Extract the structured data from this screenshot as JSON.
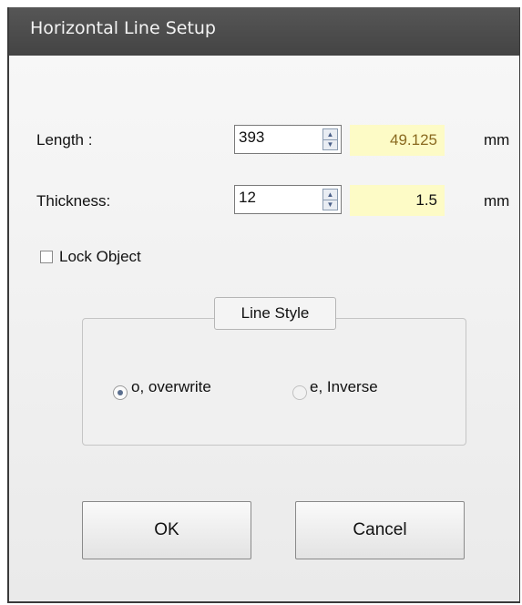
{
  "window": {
    "title": "Horizontal Line Setup"
  },
  "length": {
    "label": "Length :",
    "value": "393",
    "mm_value": "49.125",
    "unit": "mm"
  },
  "thickness": {
    "label": "Thickness:",
    "value": "12",
    "mm_value": "1.5",
    "unit": "mm"
  },
  "lock_object": {
    "label": "Lock Object",
    "checked": false
  },
  "line_style": {
    "legend": "Line Style",
    "options": [
      {
        "label": "o, overwrite",
        "selected": true
      },
      {
        "label": "e, Inverse",
        "selected": false
      }
    ]
  },
  "buttons": {
    "ok": "OK",
    "cancel": "Cancel"
  },
  "colors": {
    "title_bar": "#4a4a4a",
    "mm_field_bg": "#fdfbc6"
  },
  "icons": {
    "spin_up": "spin-up-arrow-icon",
    "spin_down": "spin-down-arrow-icon"
  }
}
